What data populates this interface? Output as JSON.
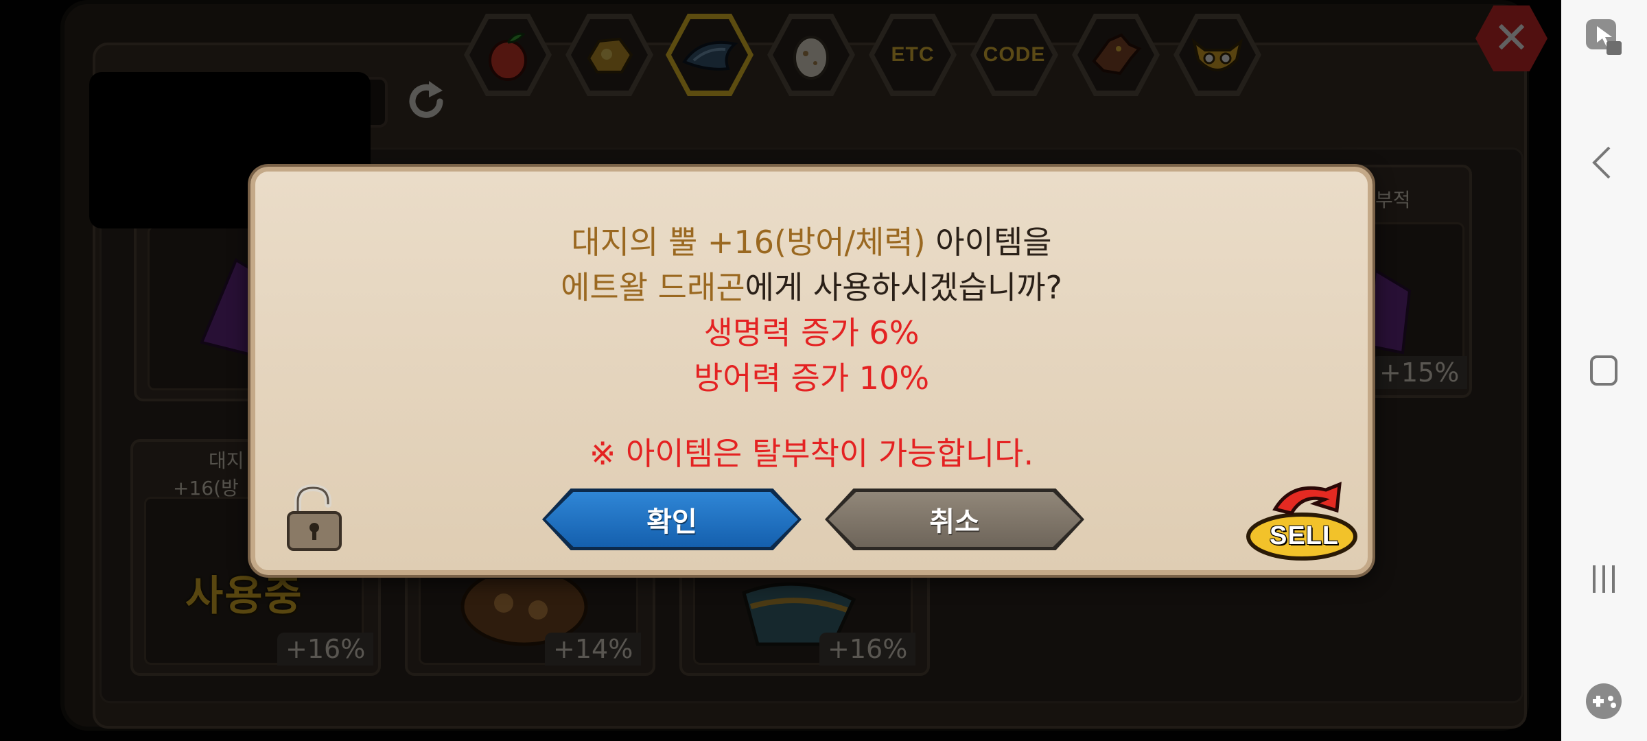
{
  "tabs": [
    {
      "name": "fruit",
      "icon": "red-fruit-icon"
    },
    {
      "name": "ore",
      "icon": "gold-ore-icon"
    },
    {
      "name": "dragon-scale",
      "icon": "dragon-scale-icon",
      "selected": true
    },
    {
      "name": "egg",
      "icon": "egg-icon"
    },
    {
      "name": "etc",
      "label": "ETC"
    },
    {
      "name": "code",
      "label": "CODE"
    },
    {
      "name": "dragon-head",
      "icon": "dragon-head-icon"
    },
    {
      "name": "goblin",
      "icon": "goblin-face-icon"
    }
  ],
  "background": {
    "cards": [
      {
        "percent": "+16%",
        "name_line1": "대지",
        "name_line2": "+16(방"
      },
      {
        "percent": "+14%"
      },
      {
        "percent": "+16%"
      },
      {
        "percent": "+15%",
        "name_top": "부적"
      }
    ],
    "in_use_label": "사용중"
  },
  "dialog": {
    "line1_item": "대지의 뿔 +16(방어/체력)",
    "line1_rest": " 아이템을",
    "line2_target": "에트왈 드래곤",
    "line2_rest": "에게 사용하시겠습니까?",
    "stat1": "생명력 증가 6%",
    "stat2": "방어력 증가 10%",
    "notice": "※ 아이템은 탈부착이 가능합니다.",
    "confirm_label": "확인",
    "cancel_label": "취소",
    "sell_label": "SELL"
  },
  "colors": {
    "item_name": "#9a6820",
    "stat_text": "#e42222",
    "confirm": "#1f6fc0",
    "cancel": "#7d7468",
    "tab_selected": "#f2c92a"
  }
}
